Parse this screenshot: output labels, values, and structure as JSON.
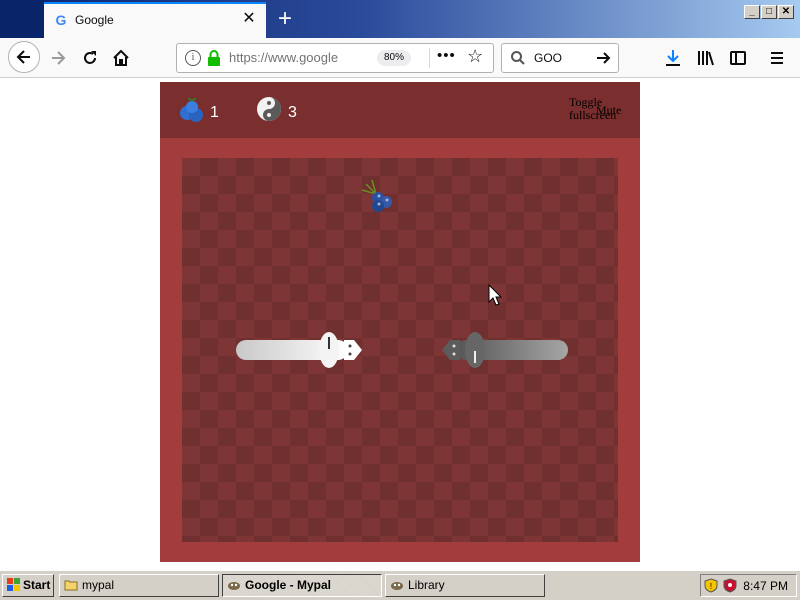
{
  "browser": {
    "tab": {
      "title": "Google",
      "favicon": "google-g-icon"
    },
    "address": {
      "url": "https://www.google",
      "zoom": "80%"
    },
    "search": {
      "value": "GOO"
    },
    "icons": {
      "back": "back-arrow-icon",
      "forward": "forward-arrow-icon",
      "reload": "reload-icon",
      "home": "home-icon",
      "info": "info-icon",
      "lock": "lock-icon",
      "more": "more-actions-icon",
      "bookmark": "star-icon",
      "search": "search-icon",
      "go": "go-arrow-icon",
      "downloads": "download-icon",
      "library": "library-icon",
      "sidebar": "sidebar-icon",
      "menu": "hamburger-menu-icon"
    }
  },
  "game": {
    "hud": {
      "blueberry_count": "1",
      "yinyang_count": "3",
      "fullscreen_label": "Toggle fullscreen",
      "mute_label": "Mute"
    },
    "colors": {
      "hud_bg": "#7a2e2e",
      "frame": "#a33c3c",
      "board_light": "#7d3535",
      "board_dark": "#713030",
      "white_snake": "#e8e8e8",
      "gray_snake": "#6e6e6e"
    }
  },
  "taskbar": {
    "start_label": "Start",
    "buttons": [
      {
        "label": "mypal",
        "active": false
      },
      {
        "label": "Google - Mypal",
        "active": true
      },
      {
        "label": "Library",
        "active": false
      }
    ],
    "clock": "8:47 PM"
  }
}
